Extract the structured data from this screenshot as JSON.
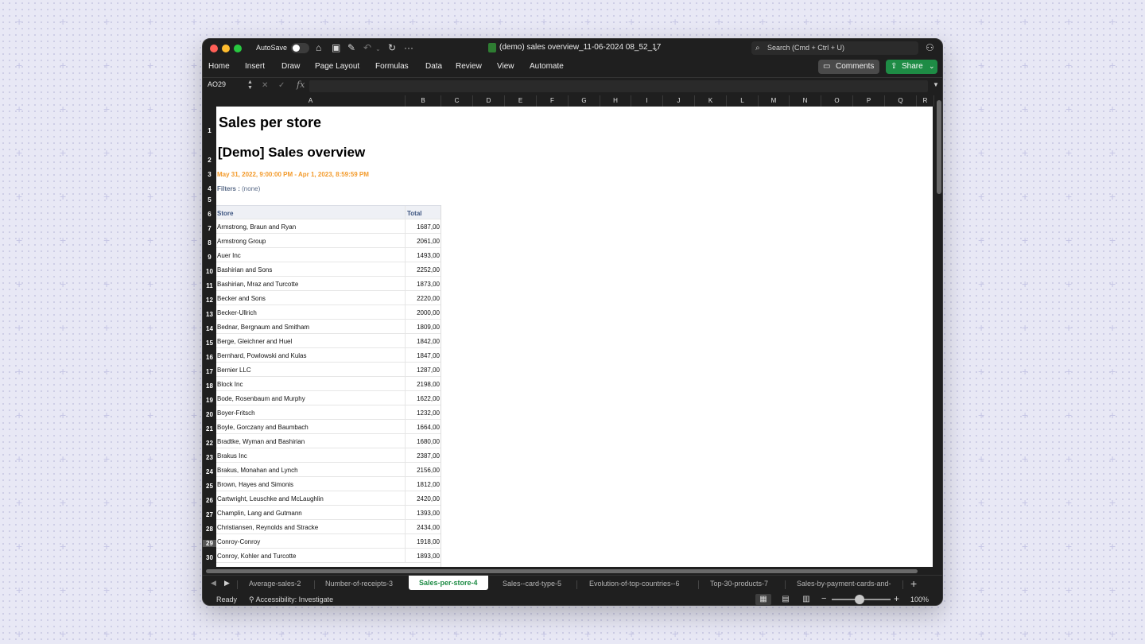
{
  "titlebar": {
    "autosave_label": "AutoSave",
    "doc_title": "(demo) sales overview_11-06-2024 08_52_17",
    "search_placeholder": "Search (Cmd + Ctrl + U)"
  },
  "ribbon": {
    "tabs": [
      "Home",
      "Insert",
      "Draw",
      "Page Layout",
      "Formulas",
      "Data",
      "Review",
      "View",
      "Automate"
    ],
    "comments_label": "Comments",
    "share_label": "Share"
  },
  "formula_bar": {
    "name_box": "AO29",
    "fx_label": "fx",
    "value": ""
  },
  "columns": [
    "A",
    "B",
    "C",
    "D",
    "E",
    "F",
    "G",
    "H",
    "I",
    "J",
    "K",
    "L",
    "M",
    "N",
    "O",
    "P",
    "Q",
    "R"
  ],
  "rows": [
    "1",
    "2",
    "3",
    "4",
    "5",
    "6",
    "7",
    "8",
    "9",
    "10",
    "11",
    "12",
    "13",
    "14",
    "15",
    "16",
    "17",
    "18",
    "19",
    "20",
    "21",
    "22",
    "23",
    "24",
    "25",
    "26",
    "27",
    "28",
    "29",
    "30"
  ],
  "sheet": {
    "title": "Sales per store",
    "subtitle": "[Demo] Sales overview",
    "date_range": "May 31, 2022, 9:00:00 PM - Apr 1, 2023, 8:59:59 PM",
    "filters_label": "Filters :",
    "filters_value": "(none)",
    "table": {
      "headers": [
        "Store",
        "Total"
      ],
      "rows": [
        [
          "Armstrong, Braun and Ryan",
          "1687,00"
        ],
        [
          "Armstrong Group",
          "2061,00"
        ],
        [
          "Auer Inc",
          "1493,00"
        ],
        [
          "Bashirian and Sons",
          "2252,00"
        ],
        [
          "Bashirian, Mraz and Turcotte",
          "1873,00"
        ],
        [
          "Becker and Sons",
          "2220,00"
        ],
        [
          "Becker-Ullrich",
          "2000,00"
        ],
        [
          "Bednar, Bergnaum and Smitham",
          "1809,00"
        ],
        [
          "Berge, Gleichner and Huel",
          "1842,00"
        ],
        [
          "Bernhard, Powlowski and Kulas",
          "1847,00"
        ],
        [
          "Bernier LLC",
          "1287,00"
        ],
        [
          "Block Inc",
          "2198,00"
        ],
        [
          "Bode, Rosenbaum and Murphy",
          "1622,00"
        ],
        [
          "Boyer-Fritsch",
          "1232,00"
        ],
        [
          "Boyle, Gorczany and Baumbach",
          "1664,00"
        ],
        [
          "Bradtke, Wyman and Bashirian",
          "1680,00"
        ],
        [
          "Brakus Inc",
          "2387,00"
        ],
        [
          "Brakus, Monahan and Lynch",
          "2156,00"
        ],
        [
          "Brown, Hayes and Simonis",
          "1812,00"
        ],
        [
          "Cartwright, Leuschke and McLaughlin",
          "2420,00"
        ],
        [
          "Champlin, Lang and Gutmann",
          "1393,00"
        ],
        [
          "Christiansen, Reynolds and Stracke",
          "2434,00"
        ],
        [
          "Conroy-Conroy",
          "1918,00"
        ],
        [
          "Conroy, Kohler and Turcotte",
          "1893,00"
        ]
      ]
    }
  },
  "sheet_tabs": {
    "tabs": [
      "Average-sales-2",
      "Number-of-receipts-3",
      "Sales-per-store-4",
      "Sales--card-type-5",
      "Evolution-of-top-countries--6",
      "Top-30-products-7",
      "Sales-by-payment-cards-and-"
    ],
    "active": "Sales-per-store-4"
  },
  "status": {
    "ready": "Ready",
    "accessibility": "Accessibility: Investigate",
    "zoom": "100%"
  },
  "colors": {
    "accent_green": "#1e8c45",
    "date_orange": "#f39a2a",
    "header_blue": "#3d5580"
  }
}
